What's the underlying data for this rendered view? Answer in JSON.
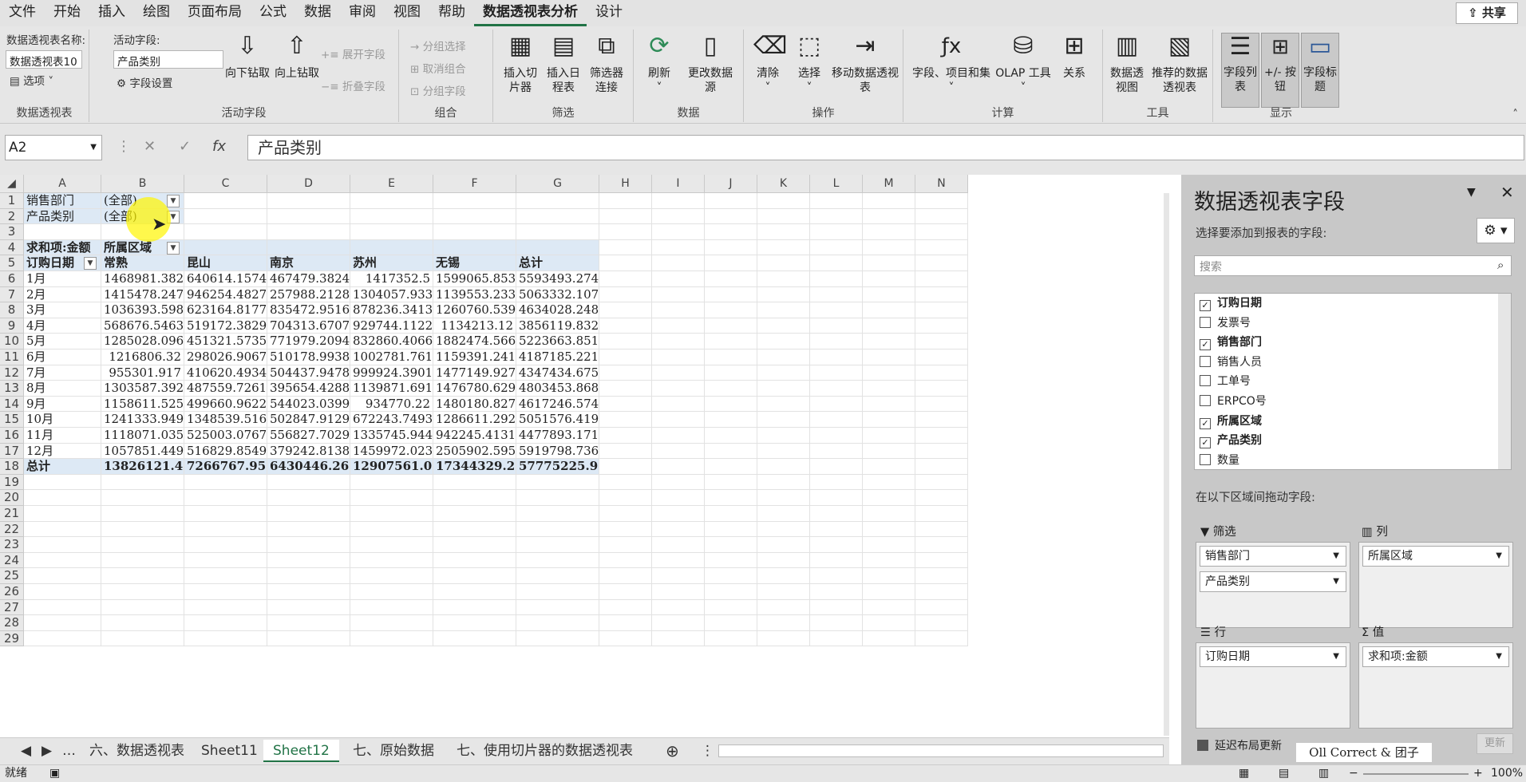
{
  "menu": [
    "文件",
    "开始",
    "插入",
    "绘图",
    "页面布局",
    "公式",
    "数据",
    "审阅",
    "视图",
    "帮助",
    "数据透视表分析",
    "设计"
  ],
  "active_menu": "数据透视表分析",
  "share_label": "共享",
  "ribbon": {
    "pivot_name_label": "数据透视表名称:",
    "pivot_name": "数据透视表10",
    "options": "选项",
    "group_pivot": "数据透视表",
    "active_field_label": "活动字段:",
    "active_field": "产品类别",
    "field_settings": "字段设置",
    "drill_down": "向下钻取",
    "drill_up": "向上钻取",
    "expand": "展开字段",
    "collapse": "折叠字段",
    "group_active": "活动字段",
    "group_sel": "分组选择",
    "ungroup": "取消组合",
    "group_field": "分组字段",
    "group_group": "组合",
    "slicer": "插入切片器",
    "timeline": "插入日程表",
    "filter_conn": "筛选器连接",
    "group_filter": "筛选",
    "refresh": "刷新",
    "change_source": "更改数据源",
    "group_data": "数据",
    "clear": "清除",
    "select": "选择",
    "move": "移动数据透视表",
    "group_ops": "操作",
    "fields_items": "字段、项目和集",
    "olap": "OLAP 工具",
    "relations": "关系",
    "group_calc": "计算",
    "pivot_chart": "数据透视图",
    "recommended": "推荐的数据透视表",
    "group_tools": "工具",
    "field_list": "字段列表",
    "plus_minus": "+/- 按钮",
    "field_headers": "字段标题",
    "group_show": "显示"
  },
  "namebox": "A2",
  "formula": "产品类别",
  "columns": [
    "A",
    "B",
    "C",
    "D",
    "E",
    "F",
    "G",
    "H",
    "I",
    "J",
    "K",
    "L",
    "M",
    "N"
  ],
  "rows": [
    "1",
    "2",
    "3",
    "4",
    "5",
    "6",
    "7",
    "8",
    "9",
    "10",
    "11",
    "12",
    "13",
    "14",
    "15",
    "16",
    "17",
    "18",
    "19",
    "20",
    "21",
    "22",
    "23",
    "24",
    "25",
    "26",
    "27",
    "28",
    "29"
  ],
  "pivot": {
    "f1_label": "销售部门",
    "f1_val": "(全部)",
    "f2_label": "产品类别",
    "f2_val": "(全部)",
    "sum_label": "求和项:金额",
    "col_field": "所属区域",
    "row_field": "订购日期",
    "headers": [
      "常熟",
      "昆山",
      "南京",
      "苏州",
      "无锡",
      "总计"
    ],
    "data": [
      [
        "1月",
        "1468981.382",
        "640614.1574",
        "467479.3824",
        "1417352.5",
        "1599065.853",
        "5593493.274"
      ],
      [
        "2月",
        "1415478.247",
        "946254.4827",
        "257988.2128",
        "1304057.933",
        "1139553.233",
        "5063332.107"
      ],
      [
        "3月",
        "1036393.598",
        "623164.8177",
        "835472.9516",
        "878236.3413",
        "1260760.539",
        "4634028.248"
      ],
      [
        "4月",
        "568676.5463",
        "519172.3829",
        "704313.6707",
        "929744.1122",
        "1134213.12",
        "3856119.832"
      ],
      [
        "5月",
        "1285028.096",
        "451321.5735",
        "771979.2094",
        "832860.4066",
        "1882474.566",
        "5223663.851"
      ],
      [
        "6月",
        "1216806.32",
        "298026.9067",
        "510178.9938",
        "1002781.761",
        "1159391.241",
        "4187185.221"
      ],
      [
        "7月",
        "955301.917",
        "410620.4934",
        "504437.9478",
        "999924.3901",
        "1477149.927",
        "4347434.675"
      ],
      [
        "8月",
        "1303587.392",
        "487559.7261",
        "395654.4288",
        "1139871.691",
        "1476780.629",
        "4803453.868"
      ],
      [
        "9月",
        "1158611.525",
        "499660.9622",
        "544023.0399",
        "934770.22",
        "1480180.827",
        "4617246.574"
      ],
      [
        "10月",
        "1241333.949",
        "1348539.516",
        "502847.9129",
        "672243.7493",
        "1286611.292",
        "5051576.419"
      ],
      [
        "11月",
        "1118071.035",
        "525003.0767",
        "556827.7029",
        "1335745.944",
        "942245.4131",
        "4477893.171"
      ],
      [
        "12月",
        "1057851.449",
        "516829.8549",
        "379242.8138",
        "1459972.023",
        "2505902.595",
        "5919798.736"
      ]
    ],
    "total": [
      "总计",
      "13826121.45",
      "7266767.95",
      "6430446.267",
      "12907561.07",
      "17344329.23",
      "57775225.98"
    ]
  },
  "tabs": [
    "六、数据透视表",
    "Sheet11",
    "Sheet12",
    "七、原始数据",
    "七、使用切片器的数据透视表"
  ],
  "active_tab": "Sheet12",
  "status": {
    "ready": "就绪",
    "zoom": "100%"
  },
  "pane": {
    "title": "数据透视表字段",
    "subtitle": "选择要添加到报表的字段:",
    "search_placeholder": "搜索",
    "fields": [
      {
        "name": "订购日期",
        "checked": true
      },
      {
        "name": "发票号",
        "checked": false
      },
      {
        "name": "销售部门",
        "checked": true
      },
      {
        "name": "销售人员",
        "checked": false
      },
      {
        "name": "工单号",
        "checked": false
      },
      {
        "name": "ERPCO号",
        "checked": false
      },
      {
        "name": "所属区域",
        "checked": true
      },
      {
        "name": "产品类别",
        "checked": true
      },
      {
        "name": "数量",
        "checked": false
      }
    ],
    "drag_label": "在以下区域间拖动字段:",
    "filter_label": "筛选",
    "col_label": "列",
    "row_label": "行",
    "val_label": "值",
    "filter_items": [
      "销售部门",
      "产品类别"
    ],
    "col_items": [
      "所属区域"
    ],
    "row_items": [
      "订购日期"
    ],
    "val_items": [
      "求和项:金额"
    ],
    "defer_label": "延迟布局更新",
    "update_btn": "更新",
    "watermark": "Oll Correct & 团子"
  }
}
